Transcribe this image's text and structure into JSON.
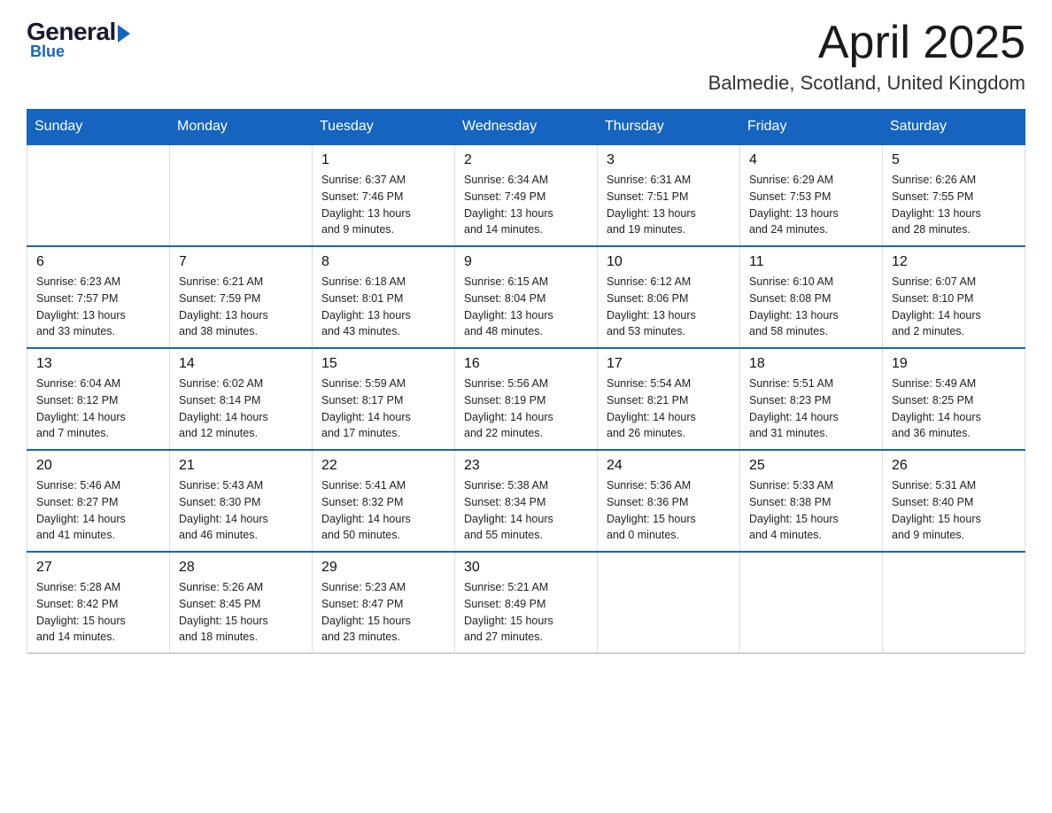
{
  "logo": {
    "general": "General",
    "blue": "Blue"
  },
  "title": {
    "month": "April 2025",
    "location": "Balmedie, Scotland, United Kingdom"
  },
  "weekdays": [
    "Sunday",
    "Monday",
    "Tuesday",
    "Wednesday",
    "Thursday",
    "Friday",
    "Saturday"
  ],
  "weeks": [
    [
      {
        "day": "",
        "info": ""
      },
      {
        "day": "",
        "info": ""
      },
      {
        "day": "1",
        "info": "Sunrise: 6:37 AM\nSunset: 7:46 PM\nDaylight: 13 hours\nand 9 minutes."
      },
      {
        "day": "2",
        "info": "Sunrise: 6:34 AM\nSunset: 7:49 PM\nDaylight: 13 hours\nand 14 minutes."
      },
      {
        "day": "3",
        "info": "Sunrise: 6:31 AM\nSunset: 7:51 PM\nDaylight: 13 hours\nand 19 minutes."
      },
      {
        "day": "4",
        "info": "Sunrise: 6:29 AM\nSunset: 7:53 PM\nDaylight: 13 hours\nand 24 minutes."
      },
      {
        "day": "5",
        "info": "Sunrise: 6:26 AM\nSunset: 7:55 PM\nDaylight: 13 hours\nand 28 minutes."
      }
    ],
    [
      {
        "day": "6",
        "info": "Sunrise: 6:23 AM\nSunset: 7:57 PM\nDaylight: 13 hours\nand 33 minutes."
      },
      {
        "day": "7",
        "info": "Sunrise: 6:21 AM\nSunset: 7:59 PM\nDaylight: 13 hours\nand 38 minutes."
      },
      {
        "day": "8",
        "info": "Sunrise: 6:18 AM\nSunset: 8:01 PM\nDaylight: 13 hours\nand 43 minutes."
      },
      {
        "day": "9",
        "info": "Sunrise: 6:15 AM\nSunset: 8:04 PM\nDaylight: 13 hours\nand 48 minutes."
      },
      {
        "day": "10",
        "info": "Sunrise: 6:12 AM\nSunset: 8:06 PM\nDaylight: 13 hours\nand 53 minutes."
      },
      {
        "day": "11",
        "info": "Sunrise: 6:10 AM\nSunset: 8:08 PM\nDaylight: 13 hours\nand 58 minutes."
      },
      {
        "day": "12",
        "info": "Sunrise: 6:07 AM\nSunset: 8:10 PM\nDaylight: 14 hours\nand 2 minutes."
      }
    ],
    [
      {
        "day": "13",
        "info": "Sunrise: 6:04 AM\nSunset: 8:12 PM\nDaylight: 14 hours\nand 7 minutes."
      },
      {
        "day": "14",
        "info": "Sunrise: 6:02 AM\nSunset: 8:14 PM\nDaylight: 14 hours\nand 12 minutes."
      },
      {
        "day": "15",
        "info": "Sunrise: 5:59 AM\nSunset: 8:17 PM\nDaylight: 14 hours\nand 17 minutes."
      },
      {
        "day": "16",
        "info": "Sunrise: 5:56 AM\nSunset: 8:19 PM\nDaylight: 14 hours\nand 22 minutes."
      },
      {
        "day": "17",
        "info": "Sunrise: 5:54 AM\nSunset: 8:21 PM\nDaylight: 14 hours\nand 26 minutes."
      },
      {
        "day": "18",
        "info": "Sunrise: 5:51 AM\nSunset: 8:23 PM\nDaylight: 14 hours\nand 31 minutes."
      },
      {
        "day": "19",
        "info": "Sunrise: 5:49 AM\nSunset: 8:25 PM\nDaylight: 14 hours\nand 36 minutes."
      }
    ],
    [
      {
        "day": "20",
        "info": "Sunrise: 5:46 AM\nSunset: 8:27 PM\nDaylight: 14 hours\nand 41 minutes."
      },
      {
        "day": "21",
        "info": "Sunrise: 5:43 AM\nSunset: 8:30 PM\nDaylight: 14 hours\nand 46 minutes."
      },
      {
        "day": "22",
        "info": "Sunrise: 5:41 AM\nSunset: 8:32 PM\nDaylight: 14 hours\nand 50 minutes."
      },
      {
        "day": "23",
        "info": "Sunrise: 5:38 AM\nSunset: 8:34 PM\nDaylight: 14 hours\nand 55 minutes."
      },
      {
        "day": "24",
        "info": "Sunrise: 5:36 AM\nSunset: 8:36 PM\nDaylight: 15 hours\nand 0 minutes."
      },
      {
        "day": "25",
        "info": "Sunrise: 5:33 AM\nSunset: 8:38 PM\nDaylight: 15 hours\nand 4 minutes."
      },
      {
        "day": "26",
        "info": "Sunrise: 5:31 AM\nSunset: 8:40 PM\nDaylight: 15 hours\nand 9 minutes."
      }
    ],
    [
      {
        "day": "27",
        "info": "Sunrise: 5:28 AM\nSunset: 8:42 PM\nDaylight: 15 hours\nand 14 minutes."
      },
      {
        "day": "28",
        "info": "Sunrise: 5:26 AM\nSunset: 8:45 PM\nDaylight: 15 hours\nand 18 minutes."
      },
      {
        "day": "29",
        "info": "Sunrise: 5:23 AM\nSunset: 8:47 PM\nDaylight: 15 hours\nand 23 minutes."
      },
      {
        "day": "30",
        "info": "Sunrise: 5:21 AM\nSunset: 8:49 PM\nDaylight: 15 hours\nand 27 minutes."
      },
      {
        "day": "",
        "info": ""
      },
      {
        "day": "",
        "info": ""
      },
      {
        "day": "",
        "info": ""
      }
    ]
  ]
}
